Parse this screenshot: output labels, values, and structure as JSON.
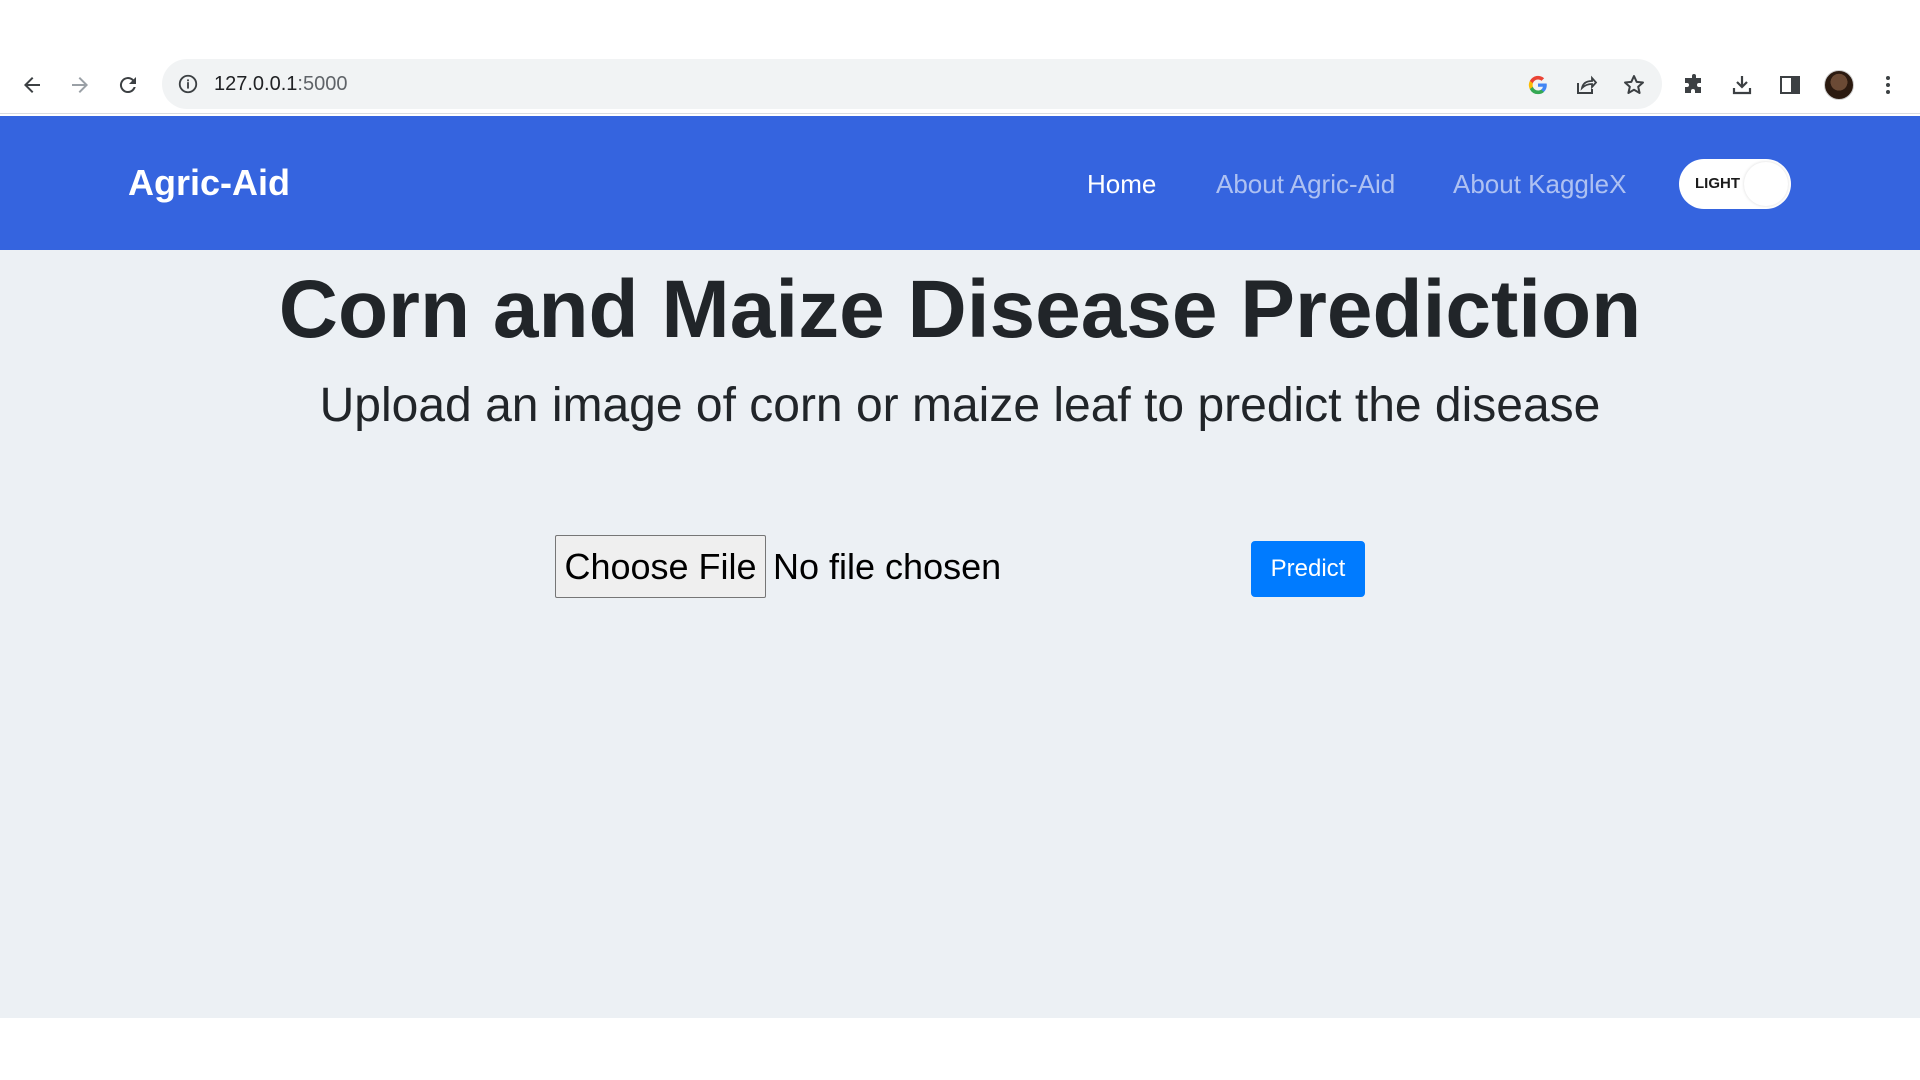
{
  "browser": {
    "url_host": "127.0.0.1",
    "url_port": ":5000"
  },
  "navbar": {
    "brand": "Agric-Aid",
    "links": [
      {
        "label": "Home"
      },
      {
        "label": "About Agric-Aid"
      },
      {
        "label": "About KaggleX"
      }
    ],
    "theme_toggle_label": "LIGHT"
  },
  "main": {
    "title": "Corn and Maize Disease Prediction",
    "subtitle": "Upload an image of corn or maize leaf to predict the disease",
    "choose_file_label": "Choose File",
    "file_status": "No file chosen",
    "predict_label": "Predict"
  },
  "colors": {
    "navbar_bg": "#3564df",
    "main_bg": "#ecf0f4",
    "predict_bg": "#007bff"
  },
  "icons": {
    "toolbar": [
      "back-arrow-icon",
      "forward-arrow-icon",
      "reload-icon"
    ],
    "omnibox": [
      "info-icon",
      "google-icon",
      "share-icon",
      "star-icon"
    ],
    "extensions": [
      "puzzle-icon",
      "download-icon",
      "side-panel-icon",
      "profile-avatar",
      "kebab-menu-icon"
    ]
  }
}
